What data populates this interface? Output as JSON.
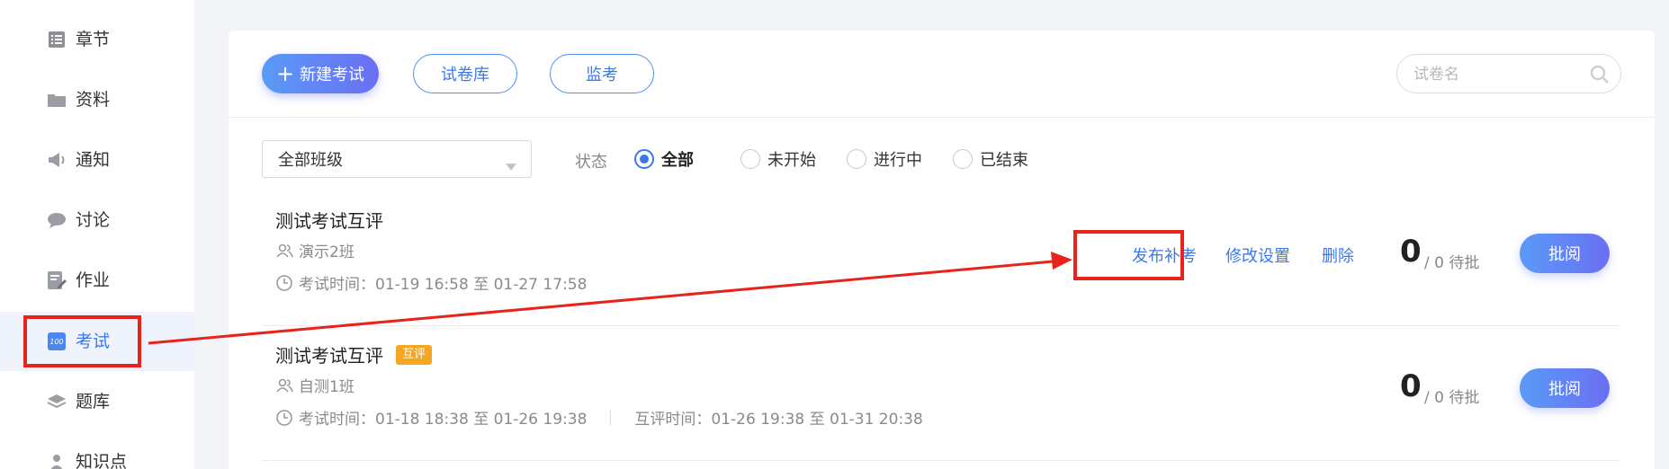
{
  "sidebar": {
    "items": [
      {
        "label": "章节",
        "icon": "list-icon"
      },
      {
        "label": "资料",
        "icon": "folder-icon"
      },
      {
        "label": "通知",
        "icon": "megaphone-icon"
      },
      {
        "label": "讨论",
        "icon": "chat-bubble-icon"
      },
      {
        "label": "作业",
        "icon": "edit-document-icon"
      },
      {
        "label": "考试",
        "icon": "exam-score-icon",
        "active": true
      },
      {
        "label": "题库",
        "icon": "layers-icon"
      },
      {
        "label": "知识点",
        "icon": "person-icon"
      }
    ]
  },
  "toolbar": {
    "new_exam_label": "新建考试",
    "paper_bank_label": "试卷库",
    "proctor_label": "监考"
  },
  "search": {
    "placeholder": "试卷名"
  },
  "filters": {
    "class_select_value": "全部班级",
    "status_label": "状态",
    "status_options": [
      {
        "label": "全部",
        "checked": true
      },
      {
        "label": "未开始",
        "checked": false
      },
      {
        "label": "进行中",
        "checked": false
      },
      {
        "label": "已结束",
        "checked": false
      }
    ]
  },
  "exams": [
    {
      "title": "测试考试互评",
      "badge": "",
      "class_name": "演示2班",
      "exam_time": "考试时间：01-19 16:58 至 01-27 17:58",
      "peer_time": "",
      "actions": [
        "发布补考",
        "修改设置",
        "删除"
      ],
      "count": "0",
      "count_suffix": "/ 0  待批",
      "review_label": "批阅"
    },
    {
      "title": "测试考试互评",
      "badge": "互评",
      "class_name": "自测1班",
      "exam_time": "考试时间：01-18 18:38 至 01-26 19:38",
      "peer_time": "互评时间：01-26 19:38 至 01-31 20:38",
      "actions": [],
      "count": "0",
      "count_suffix": "/ 0  待批",
      "review_label": "批阅"
    }
  ],
  "colors": {
    "accent": "#3a78f0",
    "annotation": "#e8231b",
    "badge": "#f5a623"
  }
}
